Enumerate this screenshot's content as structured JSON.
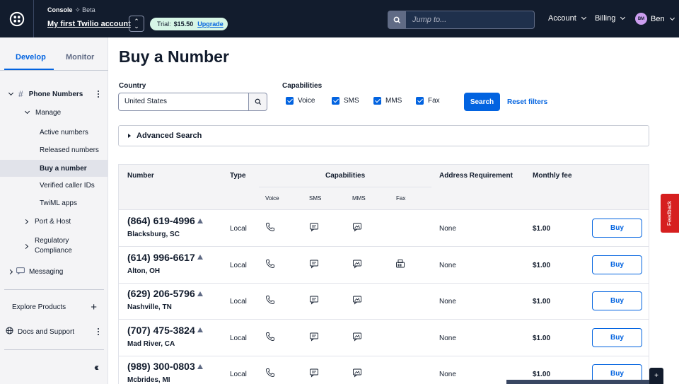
{
  "topbar": {
    "console_label": "Console",
    "beta_label": "Beta",
    "account_name": "My first Twilio account",
    "trial_label": "Trial:",
    "trial_amount": "$15.50",
    "upgrade_label": "Upgrade",
    "jump_placeholder": "Jump to...",
    "account_menu": "Account",
    "billing_menu": "Billing",
    "user_initials": "BM",
    "user_name": "Ben"
  },
  "sidebar": {
    "tabs": [
      {
        "label": "Develop"
      },
      {
        "label": "Monitor"
      }
    ],
    "section_title": "Phone Numbers",
    "manage_label": "Manage",
    "manage_items": [
      {
        "label": "Active numbers"
      },
      {
        "label": "Released numbers"
      },
      {
        "label": "Buy a number"
      },
      {
        "label": "Verified caller IDs"
      },
      {
        "label": "TwiML apps"
      }
    ],
    "port_host": "Port & Host",
    "regulatory_1": "Regulatory",
    "regulatory_2": "Compliance",
    "messaging": "Messaging",
    "explore_products": "Explore Products",
    "docs_support": "Docs and Support"
  },
  "main": {
    "title": "Buy a Number",
    "country_label": "Country",
    "country_value": "United States",
    "capabilities_label": "Capabilities",
    "capabilities": [
      {
        "label": "Voice",
        "checked": true
      },
      {
        "label": "SMS",
        "checked": true
      },
      {
        "label": "MMS",
        "checked": true
      },
      {
        "label": "Fax",
        "checked": true
      }
    ],
    "search_button": "Search",
    "reset_filters": "Reset filters",
    "advanced_search": "Advanced Search"
  },
  "table": {
    "headers": {
      "number": "Number",
      "type": "Type",
      "capabilities": "Capabilities",
      "voice": "Voice",
      "sms": "SMS",
      "mms": "MMS",
      "fax": "Fax",
      "address": "Address Requirement",
      "fee": "Monthly fee"
    },
    "rows": [
      {
        "number": "(864) 619-4996",
        "location": "Blacksburg, SC",
        "type": "Local",
        "fax": false,
        "address": "None",
        "fee": "$1.00",
        "buy": "Buy"
      },
      {
        "number": "(614) 996-6617",
        "location": "Alton, OH",
        "type": "Local",
        "fax": true,
        "address": "None",
        "fee": "$1.00",
        "buy": "Buy"
      },
      {
        "number": "(629) 206-5796",
        "location": "Nashville, TN",
        "type": "Local",
        "fax": false,
        "address": "None",
        "fee": "$1.00",
        "buy": "Buy"
      },
      {
        "number": "(707) 475-3824",
        "location": "Mad River, CA",
        "type": "Local",
        "fax": false,
        "address": "None",
        "fee": "$1.00",
        "buy": "Buy"
      },
      {
        "number": "(989) 300-0803",
        "location": "Mcbrides, MI",
        "type": "Local",
        "fax": false,
        "address": "None",
        "fee": "$1.00",
        "buy": "Buy"
      }
    ]
  },
  "feedback_label": "Feedback",
  "colors": {
    "topbar": "#121c2d",
    "primary": "#0263e0",
    "feedback": "#d61f1f",
    "trial_pill": "#d6f6e6"
  }
}
